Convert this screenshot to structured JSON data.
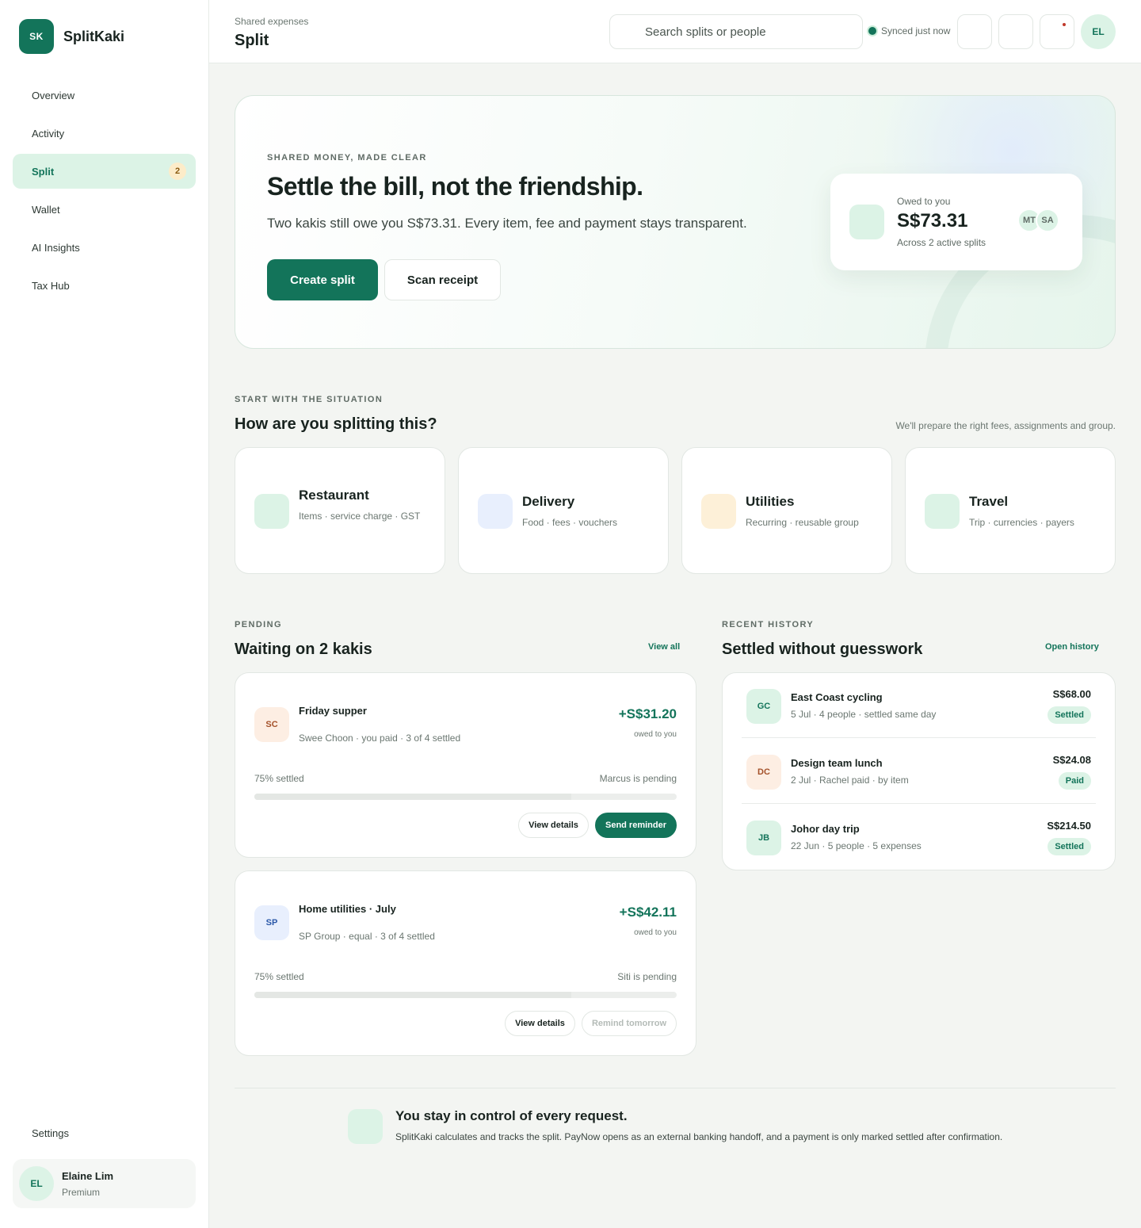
{
  "brand": {
    "logo": "SK",
    "name": "SplitKaki"
  },
  "nav": [
    {
      "label": "Overview"
    },
    {
      "label": "Activity"
    },
    {
      "label": "Split",
      "badge": "2",
      "active": true
    },
    {
      "label": "Wallet"
    },
    {
      "label": "AI Insights"
    },
    {
      "label": "Tax Hub"
    }
  ],
  "settings_label": "Settings",
  "user": {
    "initials": "EL",
    "name": "Elaine Lim",
    "plan": "Premium"
  },
  "topbar": {
    "breadcrumb": "Shared expenses",
    "title": "Split",
    "search_placeholder": "Search splits or people",
    "sync_status": "Synced just now",
    "avatar": "EL"
  },
  "hero": {
    "eyebrow": "SHARED MONEY, MADE CLEAR",
    "title": "Settle the bill, not the friendship.",
    "subtitle": "Two kakis still owe you S$73.31. Every item, fee and payment stays transparent.",
    "primary_button": "Create split",
    "secondary_button": "Scan receipt",
    "owed": {
      "label": "Owed to you",
      "amount": "S$73.31",
      "sub": "Across 2 active splits",
      "avatars": [
        "MT",
        "SA"
      ]
    }
  },
  "situation": {
    "eyebrow": "START WITH THE SITUATION",
    "title": "How are you splitting this?",
    "note": "We'll prepare the right fees, assignments and group.",
    "cards": [
      {
        "title": "Restaurant",
        "desc": "Items · service charge · GST",
        "icon": "restaurant-icon",
        "color": "#dcf3e6"
      },
      {
        "title": "Delivery",
        "desc": "Food · fees · vouchers",
        "icon": "delivery-icon",
        "color": "#e8effd"
      },
      {
        "title": "Utilities",
        "desc": "Recurring · reusable group",
        "icon": "utilities-icon",
        "color": "#fdf0d8"
      },
      {
        "title": "Travel",
        "desc": "Trip · currencies · payers",
        "icon": "travel-icon",
        "color": "#dcf3e6"
      }
    ]
  },
  "pending": {
    "eyebrow": "PENDING",
    "title": "Waiting on 2 kakis",
    "view_all": "View all",
    "items": [
      {
        "initials": "SC",
        "title": "Friday supper",
        "meta": "Swee Choon · you paid · 3 of 4 settled",
        "amount": "+S$31.20",
        "owed_label": "owed to you",
        "progress_label": "75% settled",
        "progress": 0.75,
        "pending_label": "Marcus is pending",
        "secondary": "View details",
        "primary": "Send reminder",
        "bg": "#fdeee3",
        "fg": "#a4512a"
      },
      {
        "initials": "SP",
        "title": "Home utilities · July",
        "meta": "SP Group · equal · 3 of 4 settled",
        "amount": "+S$42.11",
        "owed_label": "owed to you",
        "progress_label": "75% settled",
        "progress": 0.75,
        "pending_label": "Siti is pending",
        "secondary": "View details",
        "primary": "Remind tomorrow",
        "bg": "#e8effd",
        "fg": "#2b58a8"
      }
    ]
  },
  "history": {
    "eyebrow": "RECENT HISTORY",
    "title": "Settled without guesswork",
    "open": "Open history",
    "items": [
      {
        "initials": "GC",
        "title": "East Coast cycling",
        "meta": "5 Jul · 4 people · settled same day",
        "amount": "S$68.00",
        "status": "Settled",
        "bg": "#dcf3e6",
        "fg": "#13745a"
      },
      {
        "initials": "DC",
        "title": "Design team lunch",
        "meta": "2 Jul · Rachel paid · by item",
        "amount": "S$24.08",
        "status": "Paid",
        "bg": "#fdeee3",
        "fg": "#a4512a"
      },
      {
        "initials": "JB",
        "title": "Johor day trip",
        "meta": "22 Jun · 5 people · 5 expenses",
        "amount": "S$214.50",
        "status": "Settled",
        "bg": "#dcf3e6",
        "fg": "#13745a"
      }
    ]
  },
  "footer": {
    "title": "You stay in control of every request.",
    "text": "SplitKaki calculates and tracks the split. PayNow opens as an external banking handoff, and a payment is only marked settled after confirmation."
  }
}
